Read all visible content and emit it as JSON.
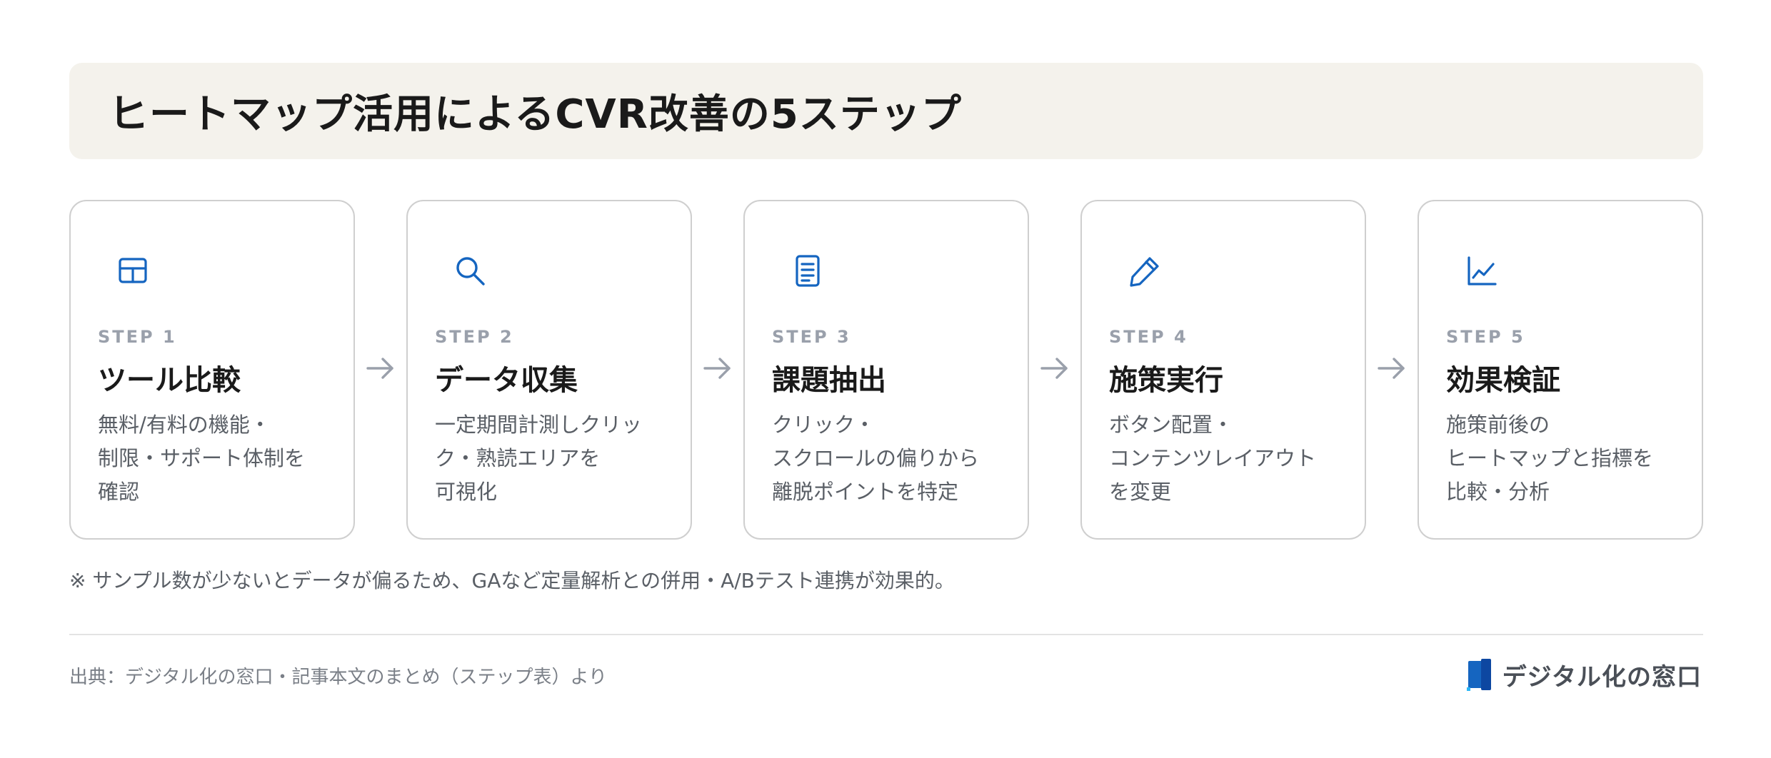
{
  "title": "ヒートマップ活用によるCVR改善の5ステップ",
  "accent_color": "#1565c0",
  "steps": [
    {
      "label": "STEP 1",
      "title": "ツール比較",
      "description": "無料/有料の機能・\n制限・サポート体制を\n確認",
      "icon": "table-icon"
    },
    {
      "label": "STEP 2",
      "title": "データ収集",
      "description": "一定期間計測しクリッ\nク・熟読エリアを\n可視化",
      "icon": "search-icon"
    },
    {
      "label": "STEP 3",
      "title": "課題抽出",
      "description": "クリック・\nスクロールの偏りから\n離脱ポイントを特定",
      "icon": "document-icon"
    },
    {
      "label": "STEP 4",
      "title": "施策実行",
      "description": "ボタン配置・\nコンテンツレイアウト\nを変更",
      "icon": "pencil-icon"
    },
    {
      "label": "STEP 5",
      "title": "効果検証",
      "description": "施策前後の\nヒートマップと指標を\n比較・分析",
      "icon": "line-chart-icon"
    }
  ],
  "note": "※ サンプル数が少ないとデータが偏るため、GAなど定量解析との併用・A/Bテスト連携が効果的。",
  "source": "出典：デジタル化の窓口・記事本文のまとめ（ステップ表）より",
  "brand": {
    "name": "デジタル化の窓口",
    "logo_icon": "window-logo-icon"
  }
}
